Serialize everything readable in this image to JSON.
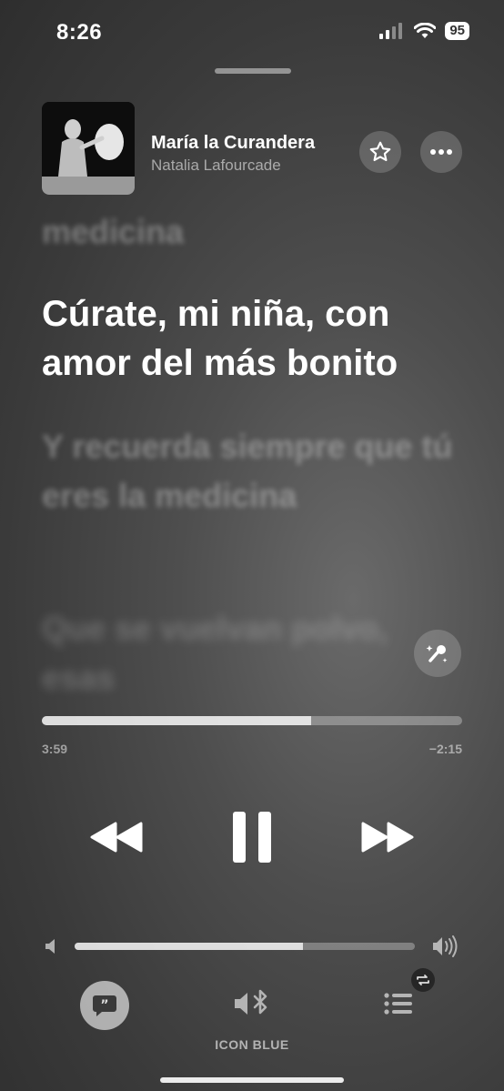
{
  "status_bar": {
    "time": "8:26",
    "battery": "95"
  },
  "now_playing": {
    "title": "María la Curandera",
    "artist": "Natalia Lafourcade"
  },
  "lyrics": {
    "previous": "medicina",
    "current": "Cúrate, mi niña, con amor del más bonito",
    "next": "Y recuerda siempre que tú eres la medicina",
    "upcoming": "Que se vuelvan polvo, esas"
  },
  "playback": {
    "elapsed": "3:59",
    "remaining": "−2:15",
    "progress_fraction": 0.64
  },
  "volume": {
    "level_fraction": 0.67
  },
  "output_device": "ICON BLUE",
  "colors": {
    "accent": "#ffffff"
  }
}
